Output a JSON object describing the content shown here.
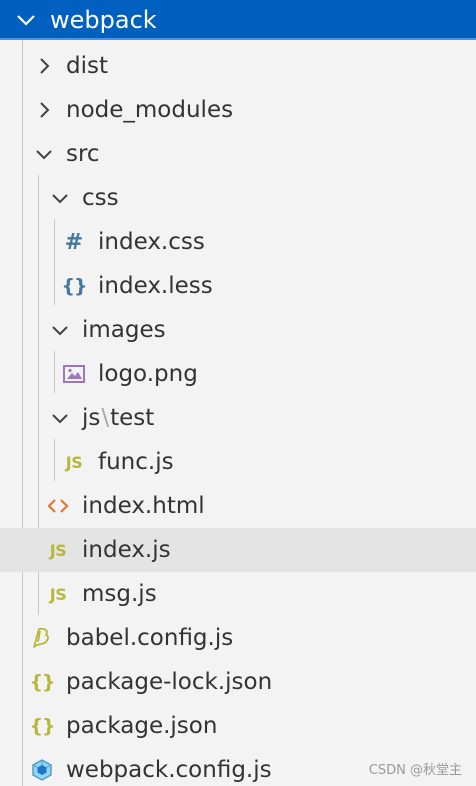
{
  "root": {
    "title": "webpack"
  },
  "tree": {
    "dist": "dist",
    "node_modules": "node_modules",
    "src": "src",
    "css": "css",
    "index_css": "index.css",
    "index_less": "index.less",
    "images": "images",
    "logo_png": "logo.png",
    "js_folder": "js",
    "js_test_folder": "test",
    "func_js": "func.js",
    "index_html": "index.html",
    "index_js": "index.js",
    "msg_js": "msg.js",
    "babel_config": "babel.config.js",
    "package_lock": "package-lock.json",
    "package_json": "package.json",
    "webpack_config": "webpack.config.js"
  },
  "icons": {
    "folder_chevron": "chevron-icon",
    "css_file": "hash-icon",
    "less_file": "braces-icon",
    "image_file": "image-icon",
    "js_file": "js-icon",
    "html_file": "html-brackets-icon",
    "babel_file": "babel-icon",
    "json_file": "json-braces-icon",
    "webpack_file": "webpack-cube-icon"
  },
  "colors": {
    "header_bg": "#0060c0",
    "selected_row": "#e4e4e4",
    "css_icon": "#42789e",
    "js_icon": "#b7b73b",
    "json_icon": "#b7b73b",
    "html_icon": "#e37933",
    "image_icon": "#a074c4",
    "webpack_icon": "#519aba"
  },
  "watermark": "CSDN @秋堂主"
}
